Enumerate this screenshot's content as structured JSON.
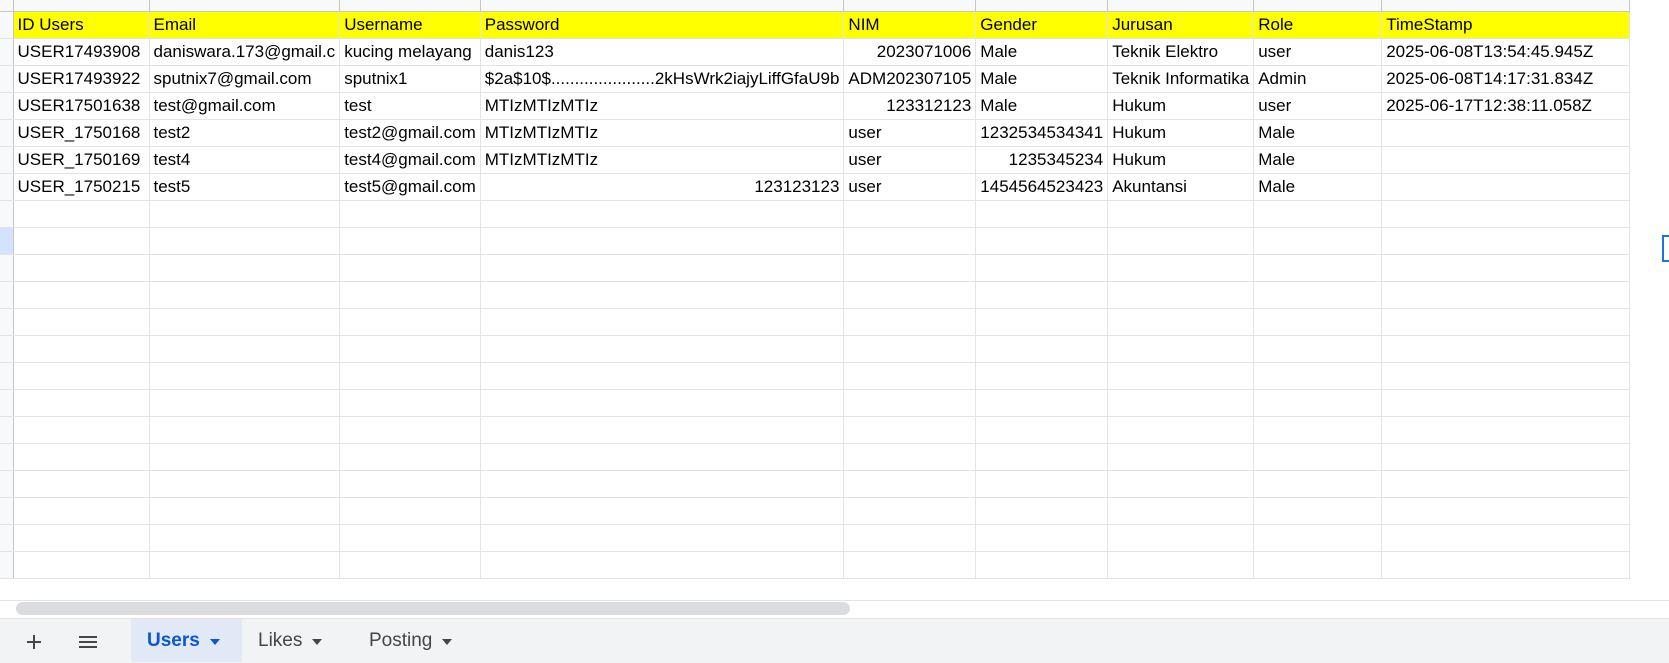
{
  "sheet": {
    "columns": [
      "ID Users",
      "Email",
      "Username",
      "Password",
      "NIM",
      "Gender",
      "Jurusan",
      "Role",
      "TimeStamp"
    ],
    "rows": [
      [
        "USER17493908",
        "daniswara.173@gmail.c",
        "kucing melayang",
        "danis123",
        "2023071006",
        "Male",
        "Teknik Elektro",
        "user",
        "2025-06-08T13:54:45.945Z"
      ],
      [
        "USER17493922",
        "sputnix7@gmail.com",
        "sputnix1",
        "$2a$10$......................2kHsWrk2iajyLiffGfaU9b",
        "ADM202307105",
        "Male",
        "Teknik Informatika",
        "Admin",
        "2025-06-08T14:17:31.834Z"
      ],
      [
        "USER17501638",
        "test@gmail.com",
        "test",
        "MTIzMTIzMTIz",
        "123312123",
        "Male",
        "Hukum",
        "user",
        "2025-06-17T12:38:11.058Z"
      ],
      [
        "USER_1750168",
        "test2",
        "test2@gmail.com",
        "MTIzMTIzMTIz",
        "user",
        "1232534534341",
        "Hukum",
        "Male",
        ""
      ],
      [
        "USER_1750169",
        "test4",
        "test4@gmail.com",
        "MTIzMTIzMTIz",
        "user",
        "1235345234",
        "Hukum",
        "Male",
        ""
      ],
      [
        "USER_1750215",
        "test5",
        "test5@gmail.com",
        "123123123",
        "user",
        "1454564523423",
        "Akuntansi",
        "Male",
        ""
      ]
    ],
    "numeric_cells": [
      [
        0,
        4
      ],
      [
        2,
        4
      ],
      [
        3,
        5
      ],
      [
        4,
        5
      ],
      [
        5,
        3
      ],
      [
        5,
        5
      ]
    ],
    "header_fill": "#ffff00",
    "empty_rows": 14,
    "selected_empty_row": 1
  },
  "sheet_tabs": [
    {
      "label": "Users",
      "active": true
    },
    {
      "label": "Likes",
      "active": false
    },
    {
      "label": "Posting",
      "active": false
    }
  ],
  "toolbar": {
    "add_icon": "plus-icon",
    "menu_icon": "hamburger-menu-icon"
  },
  "colors": {
    "active_tab": "#0b57d0",
    "selection": "#1a73e8"
  }
}
